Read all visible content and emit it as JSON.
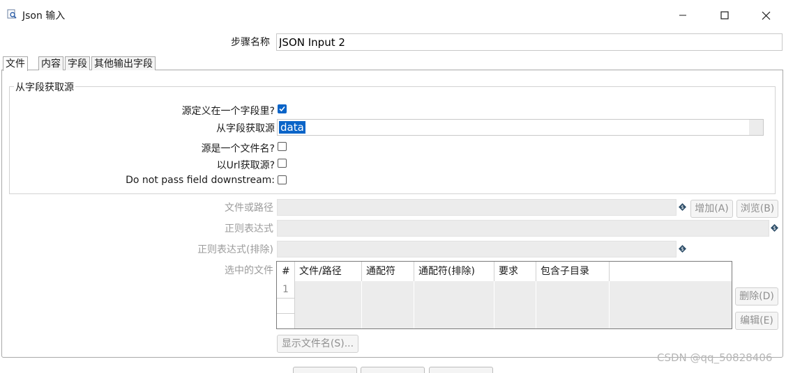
{
  "window": {
    "title": "Json 输入",
    "minimize_icon": "minimize-icon",
    "maximize_icon": "maximize-icon",
    "close_icon": "close-icon"
  },
  "step": {
    "label": "步骤名称",
    "value": "JSON Input 2"
  },
  "tabs": [
    {
      "label": "文件",
      "active": true
    },
    {
      "label": "内容",
      "active": false
    },
    {
      "label": "字段",
      "active": false
    },
    {
      "label": "其他输出字段",
      "active": false
    }
  ],
  "source_group": {
    "title": "从字段获取源",
    "source_in_field_label": "源定义在一个字段里?",
    "source_in_field_checked": true,
    "field_label": "从字段获取源",
    "field_value": "data",
    "is_filename_label": "源是一个文件名?",
    "is_filename_checked": false,
    "from_url_label": "以Url获取源?",
    "from_url_checked": false,
    "no_pass_label": "Do not pass field downstream:",
    "no_pass_checked": false
  },
  "file": {
    "path_label": "文件或路径",
    "regex_label": "正则表达式",
    "regex_exclude_label": "正则表达式(排除)",
    "selected_label": "选中的文件",
    "add_button": "增加(A)",
    "browse_button": "浏览(B)",
    "delete_button": "删除(D)",
    "edit_button": "编辑(E)",
    "show_files_button": "显示文件名(S)..."
  },
  "table": {
    "columns": [
      "#",
      "文件/路径",
      "通配符",
      "通配符(排除)",
      "要求",
      "包含子目录"
    ],
    "rows": [
      "1"
    ]
  },
  "watermark": "CSDN @qq_50828406"
}
